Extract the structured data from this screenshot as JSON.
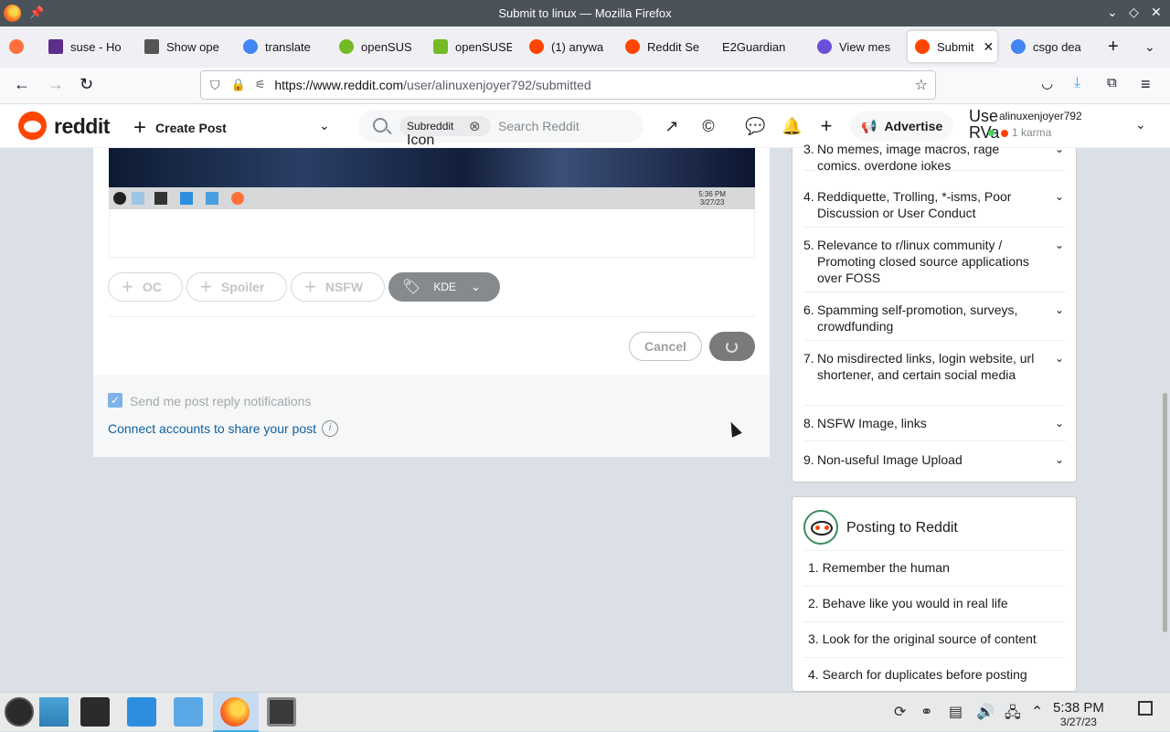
{
  "window": {
    "title": "Submit to linux — Mozilla Firefox"
  },
  "tabs": [
    {
      "label": "suse - Ho",
      "color": "#5b2f8b"
    },
    {
      "label": "Show ope",
      "color": "#555555"
    },
    {
      "label": "translate",
      "color": "#4285f4"
    },
    {
      "label": "openSUSE",
      "color": "#73ba25"
    },
    {
      "label": "openSUSE",
      "color": "#73ba25"
    },
    {
      "label": "(1) anywa",
      "color": "#ff4500"
    },
    {
      "label": "Reddit Se",
      "color": "#ff4500"
    },
    {
      "label": "E2Guardian",
      "color": "#f9f9fb"
    },
    {
      "label": "View mes",
      "color": "#6b4fd8"
    },
    {
      "label": "Submit",
      "color": "#ff4500"
    },
    {
      "label": "csgo dea",
      "color": "#4285f4"
    }
  ],
  "url": {
    "host": "https://www.reddit.com",
    "path": "/user/alinuxenjoyer792/submitted"
  },
  "header": {
    "logo_text": "reddit",
    "create_post": "Create Post",
    "chip_label": "Subreddit",
    "chip_icon_text": "Icon",
    "search_placeholder": "Search Reddit",
    "advertise": "Advertise",
    "user_fragment": "Use",
    "user_fragment2": "RVa",
    "username": "alinuxenjoyer792",
    "karma": "1 karma"
  },
  "composer": {
    "preview_clock_time": "5:36 PM",
    "preview_clock_date": "3/27/23",
    "flair_pills": [
      {
        "label": "OC"
      },
      {
        "label": "Spoiler"
      },
      {
        "label": "NSFW"
      }
    ],
    "flair_selected": "KDE",
    "cancel": "Cancel"
  },
  "notifications": {
    "checkbox_checked": true,
    "label": "Send me post reply notifications",
    "connect": "Connect accounts to share your post"
  },
  "rules": [
    {
      "num": "3.",
      "text": "No memes, image macros, rage comics, overdone jokes"
    },
    {
      "num": "4.",
      "text": "Reddiquette, Trolling, *-isms, Poor Discussion or User Conduct"
    },
    {
      "num": "5.",
      "text": "Relevance to r/linux community / Promoting closed source applications over FOSS"
    },
    {
      "num": "6.",
      "text": "Spamming self-promotion, surveys, crowdfunding"
    },
    {
      "num": "7.",
      "text": "No misdirected links, login website, url shortener, and certain social media"
    },
    {
      "num": "8.",
      "text": "NSFW Image, links"
    },
    {
      "num": "9.",
      "text": "Non-useful Image Upload"
    }
  ],
  "posting": {
    "title": "Posting to Reddit",
    "items": [
      "1. Remember the human",
      "2. Behave like you would in real life",
      "3. Look for the original source of content",
      "4. Search for duplicates before posting"
    ]
  },
  "taskbar": {
    "time": "5:38 PM",
    "date": "3/27/23"
  },
  "colors": {
    "reddit_orange": "#ff4500",
    "link_blue": "#0f5f9c"
  }
}
